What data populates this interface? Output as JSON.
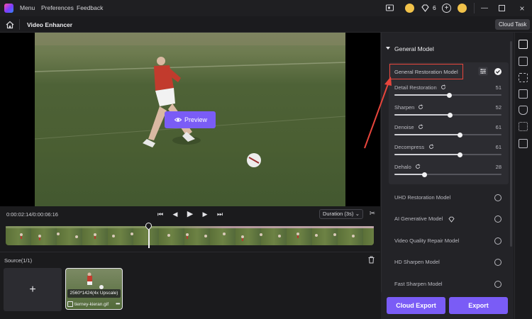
{
  "menu": {
    "items": [
      "Menu",
      "Preferences",
      "Feedback"
    ]
  },
  "titlebar": {
    "credits": "6"
  },
  "header": {
    "title": "Video Enhancer",
    "cloud_task": "Cloud Task"
  },
  "preview": {
    "label": "Preview"
  },
  "player": {
    "time": "0:00:02:14/0:00:06:16",
    "duration_select": "Duration (3s)"
  },
  "source": {
    "label": "Source(1/1)",
    "add_symbol": "+",
    "item": {
      "resolution": "2560*1424(4x Upscale)",
      "filename": "tierney-kieran.gif",
      "more": "•••"
    }
  },
  "panel": {
    "section_title": "General Model",
    "selected_model": "General Restoration Model",
    "sliders": [
      {
        "label": "Detail Restoration",
        "value": 51
      },
      {
        "label": "Sharpen",
        "value": 52
      },
      {
        "label": "Denoise",
        "value": 61
      },
      {
        "label": "Decompress",
        "value": 61
      },
      {
        "label": "Dehalo",
        "value": 28
      }
    ],
    "models": [
      {
        "label": "UHD Restoration Model"
      },
      {
        "label": "AI Generative Model",
        "badge_icon": "diamond-icon"
      },
      {
        "label": "Video Quality Repair Model"
      },
      {
        "label": "HD Sharpen Model"
      },
      {
        "label": "Fast Sharpen Model"
      }
    ]
  },
  "actions": {
    "cloud_export": "Cloud Export",
    "export": "Export"
  },
  "colors": {
    "accent": "#7a5cf6",
    "highlight_red": "#e8453c"
  }
}
